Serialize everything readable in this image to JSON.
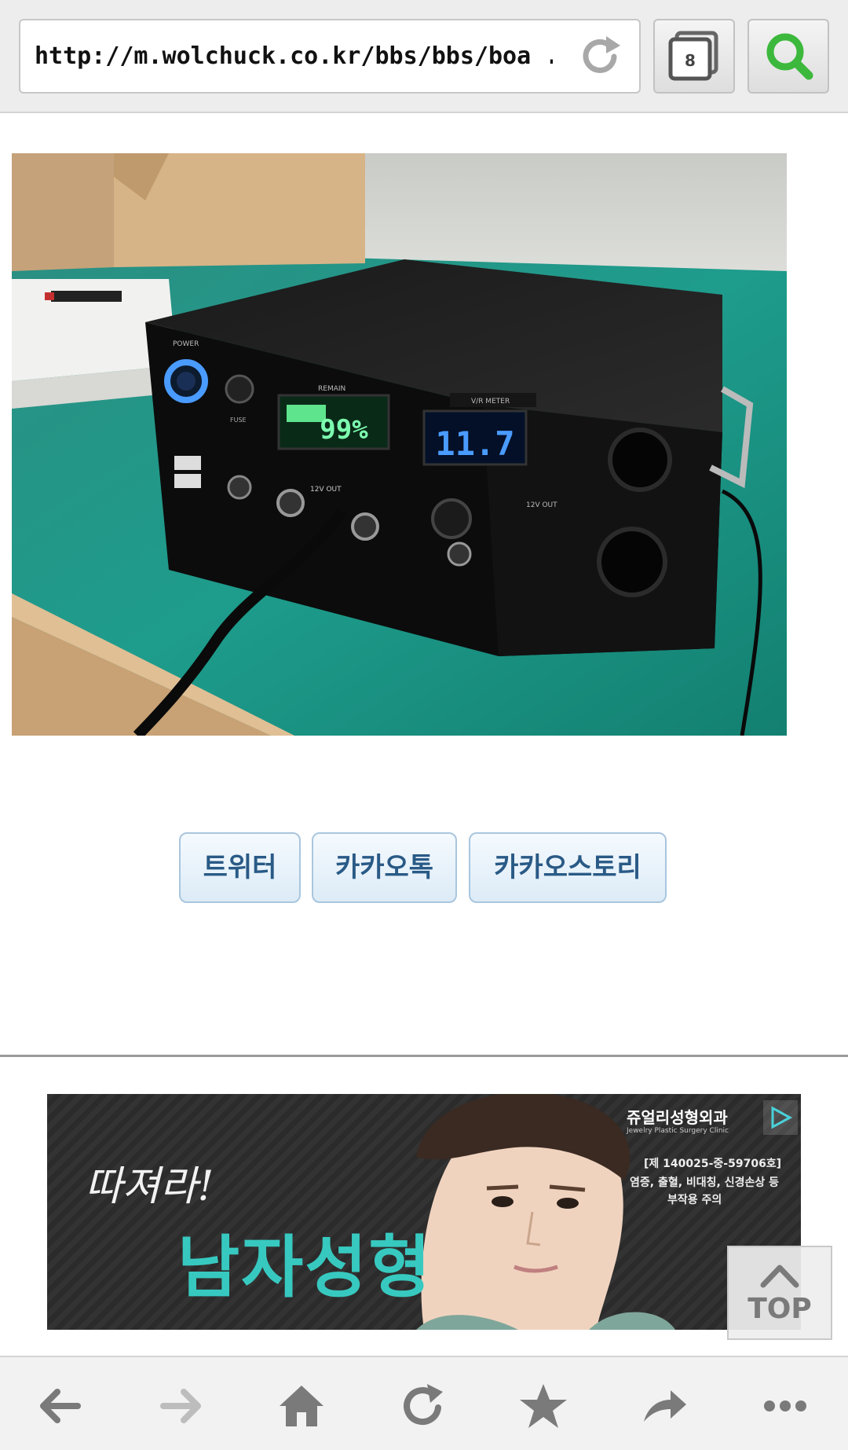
{
  "browser": {
    "url": "http://m.wolchuck.co.kr/bbs/bbs/boa ...",
    "tab_count": "8",
    "icons": {
      "reload": "reload-icon",
      "tabs": "tabs-icon",
      "search": "search-icon",
      "back": "back-arrow-icon",
      "forward": "forward-arrow-icon",
      "home": "home-icon",
      "refresh": "refresh-icon",
      "bookmark": "star-icon",
      "share": "share-icon",
      "more": "more-icon"
    }
  },
  "photo": {
    "remain_label": "REMAIN",
    "battery_percent": "99%",
    "voltmeter_label": "V/R METER",
    "voltage": "11.7",
    "power_label": "POWER",
    "fuse_label": "FUSE",
    "out_label": "12V OUT",
    "side_out_label": "12V OUT"
  },
  "share": {
    "twitter": "트위터",
    "kakaotalk": "카카오톡",
    "kakaostory": "카카오스토리"
  },
  "ad": {
    "slogan": "따져라!",
    "headline": "남자성형",
    "brand": "쥬얼리성형외과",
    "brand_sub": "Jewelry Plastic Surgery Clinic",
    "note_line1": "[제 140025-중-59706호]",
    "note_line2": "염증, 출혈, 비대칭, 신경손상 등",
    "note_line3": "부작용 주의"
  },
  "top_button": {
    "label": "TOP"
  },
  "colors": {
    "toolbar_bg": "#ededed",
    "search_green": "#3cb83c",
    "share_text": "#2a5a86",
    "ad_teal": "#37c9c0",
    "lcd_green": "#7dffb0",
    "led_blue": "#4a9bff"
  }
}
